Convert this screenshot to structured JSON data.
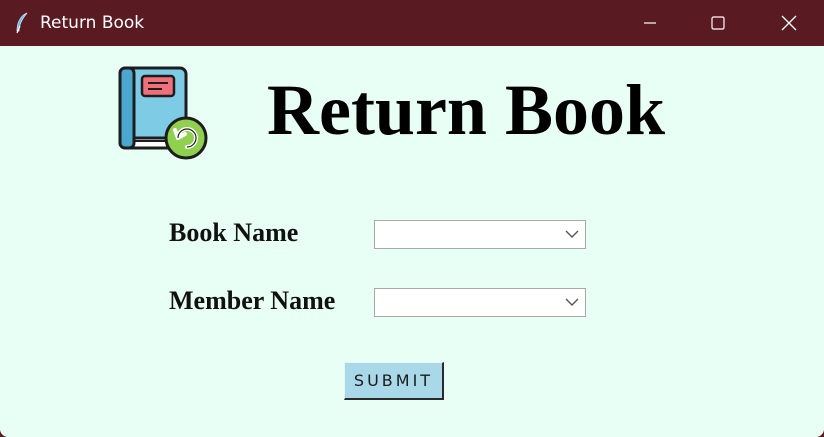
{
  "window": {
    "title": "Return Book",
    "app_icon": "feather-icon",
    "controls": {
      "minimize": "minimize-icon",
      "maximize": "maximize-icon",
      "close": "close-icon"
    }
  },
  "header": {
    "icon": "book-return-icon",
    "title": "Return Book"
  },
  "form": {
    "book_name_label": "Book Name",
    "book_name_value": "",
    "member_name_label": "Member Name",
    "member_name_value": "",
    "submit_label": "SUBMIT"
  },
  "colors": {
    "titlebar": "#5a1a22",
    "background": "#e8fff6",
    "submit_button": "#a9d8e8"
  }
}
